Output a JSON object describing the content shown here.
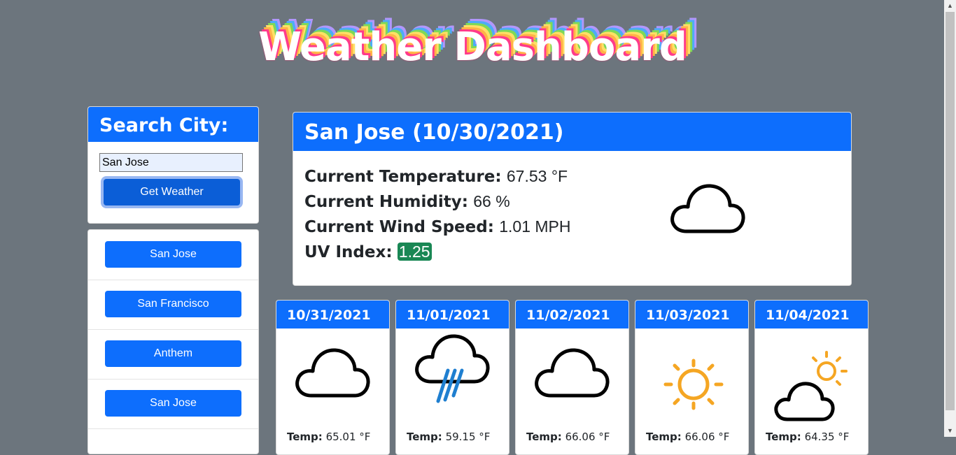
{
  "header": {
    "title": "Weather Dashboard"
  },
  "search": {
    "heading": "Search City:",
    "input_value": "San Jose",
    "button_label": "Get Weather"
  },
  "history": {
    "items": [
      {
        "label": "San Jose"
      },
      {
        "label": "San Francisco"
      },
      {
        "label": "Anthem"
      },
      {
        "label": "San Jose"
      }
    ]
  },
  "current": {
    "heading": "San Jose (10/30/2021)",
    "temperature_label": "Current Temperature:",
    "temperature_value": "67.53 °F",
    "humidity_label": "Current Humidity:",
    "humidity_value": "66 %",
    "wind_label": "Current Wind Speed:",
    "wind_value": "1.01 MPH",
    "uv_label": "UV Index:",
    "uv_value": "1.25",
    "icon": "cloud-icon"
  },
  "forecast": [
    {
      "date": "10/31/2021",
      "icon": "cloud-icon",
      "temp_label": "Temp:",
      "temp_value": "65.01 °F"
    },
    {
      "date": "11/01/2021",
      "icon": "rain-cloud-icon",
      "temp_label": "Temp:",
      "temp_value": "59.15 °F"
    },
    {
      "date": "11/02/2021",
      "icon": "cloud-icon",
      "temp_label": "Temp:",
      "temp_value": "66.06 °F"
    },
    {
      "date": "11/03/2021",
      "icon": "sun-icon",
      "temp_label": "Temp:",
      "temp_value": "66.06 °F"
    },
    {
      "date": "11/04/2021",
      "icon": "partly-cloudy-icon",
      "temp_label": "Temp:",
      "temp_value": "64.35 °F"
    }
  ],
  "colors": {
    "background": "#6c757d",
    "primary": "#0d6efd",
    "uv_badge": "#198754",
    "sun": "#f5a623"
  }
}
